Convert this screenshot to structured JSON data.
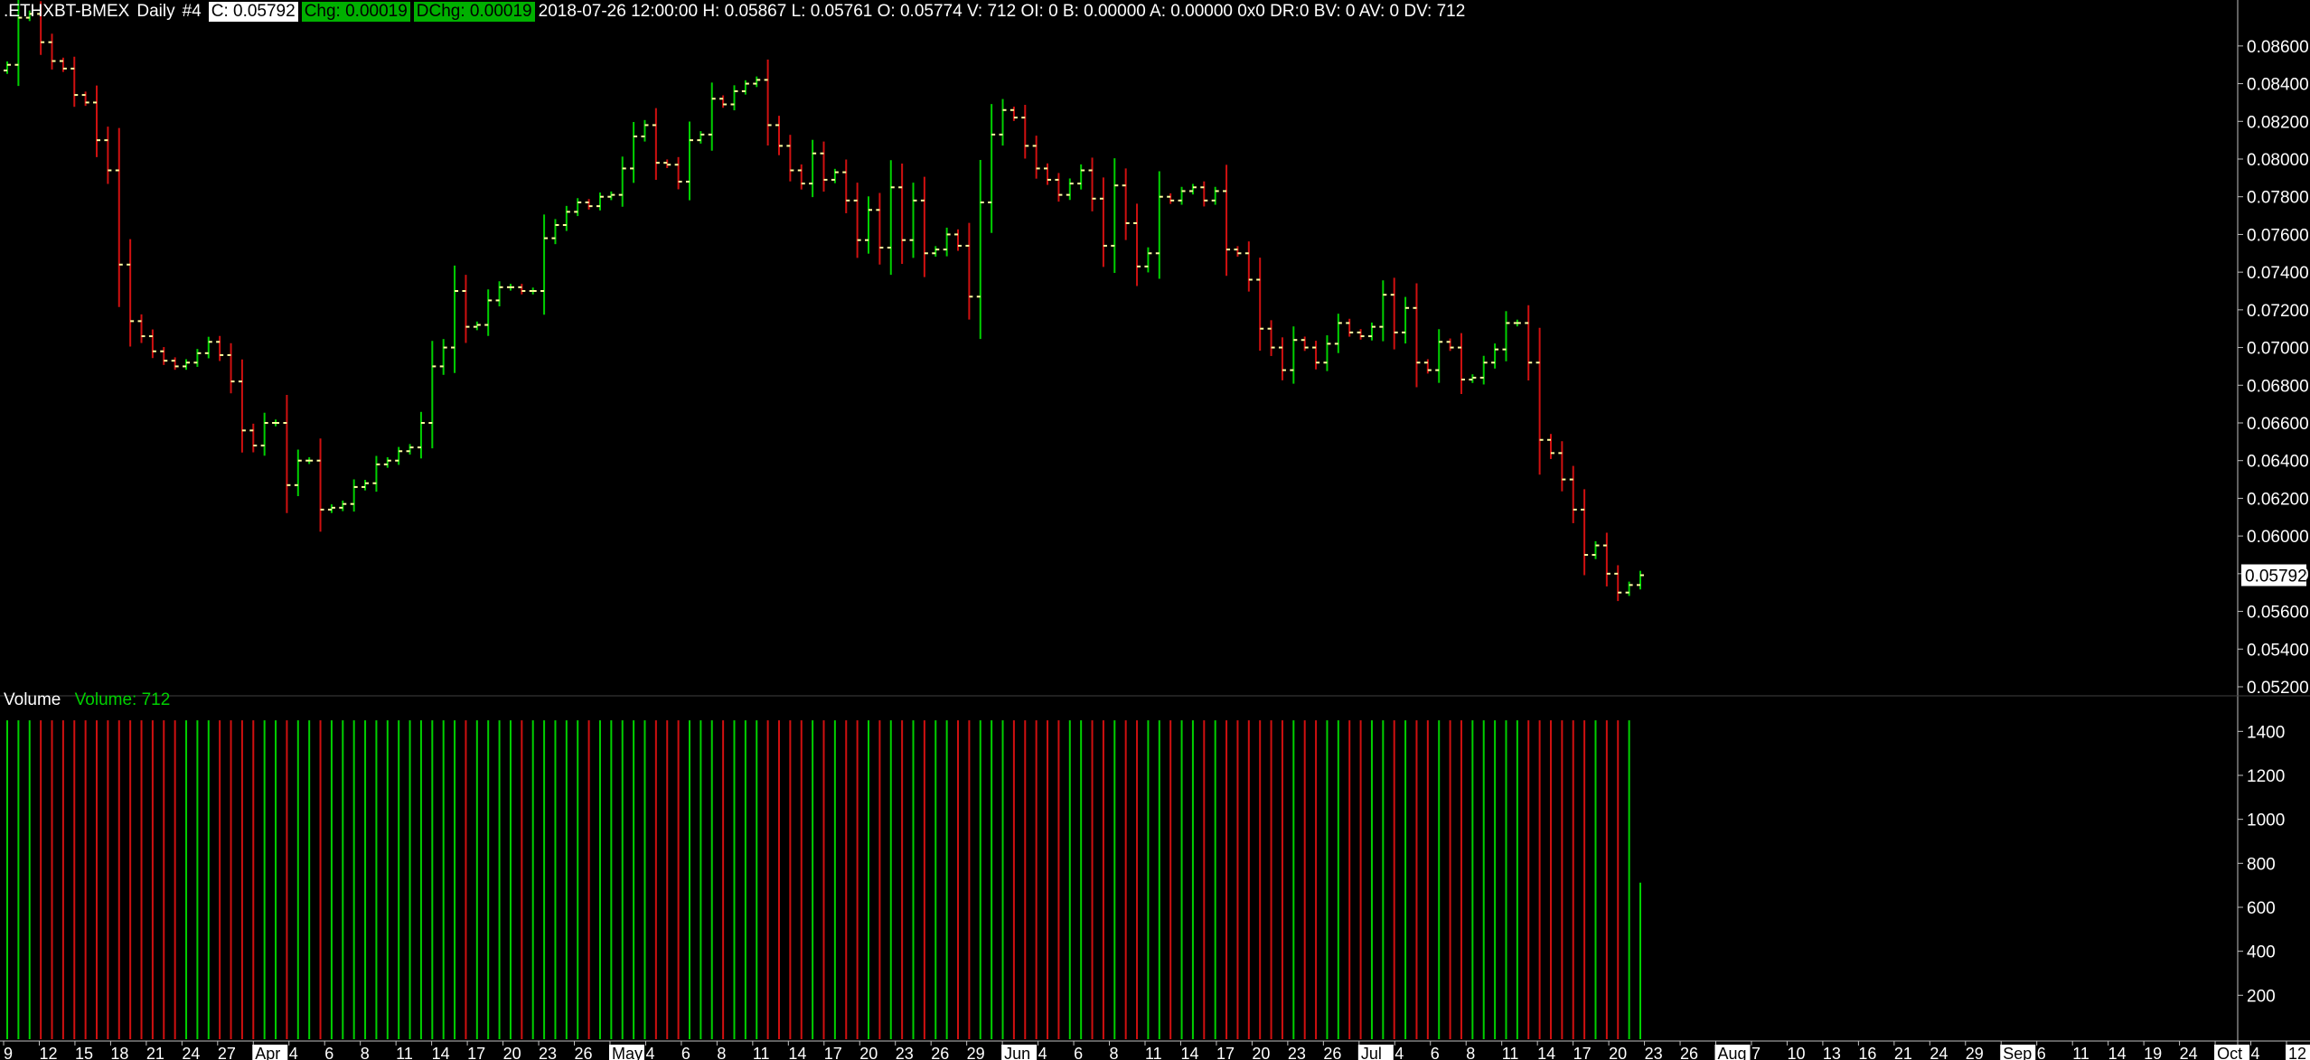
{
  "header": {
    "symbol": ".ETHXBT-BMEX",
    "interval": "Daily",
    "id": "#4",
    "close": "C: 0.05792",
    "chg": "Chg: 0.00019",
    "dchg": "DChg: 0.00019",
    "info": "2018-07-26 12:00:00 H: 0.05867 L: 0.05761 O: 0.05774 V: 712 OI: 0 B: 0.00000 A: 0.00000 0x0 DR:0 BV: 0 AV: 0 DV: 712"
  },
  "volume_header": {
    "label": "Volume",
    "value": "Volume: 712"
  },
  "colors": {
    "up": "#00d000",
    "down": "#d01010",
    "tick": "#ffffa0",
    "axis": "#ffffff",
    "month_bg": "#ffffff"
  },
  "chart_data": [
    {
      "type": "ohlc",
      "title": ".ETHXBT-BMEX Daily",
      "price_axis": {
        "ylim": [
          0.052,
          0.087
        ],
        "ticks": [
          "0.05200",
          "0.05400",
          "0.05600",
          "0.05800",
          "0.06000",
          "0.06200",
          "0.06400",
          "0.06600",
          "0.06800",
          "0.07000",
          "0.07200",
          "0.07400",
          "0.07600",
          "0.07800",
          "0.08000",
          "0.08200",
          "0.08400",
          "0.08600"
        ],
        "last_value_label": "0.05792",
        "last_value": 0.05792
      },
      "dates_start": "2018-03-09",
      "dates_end": "2018-07-26",
      "close": [
        0.085,
        0.0875,
        0.0877,
        0.0862,
        0.0852,
        0.0848,
        0.0834,
        0.083,
        0.081,
        0.0794,
        0.0744,
        0.0714,
        0.0706,
        0.0698,
        0.0693,
        0.069,
        0.0692,
        0.0697,
        0.0703,
        0.0696,
        0.0682,
        0.0656,
        0.0648,
        0.066,
        0.066,
        0.0627,
        0.064,
        0.064,
        0.0614,
        0.0615,
        0.0617,
        0.0626,
        0.0628,
        0.0638,
        0.064,
        0.0645,
        0.0647,
        0.066,
        0.069,
        0.07,
        0.073,
        0.0711,
        0.0712,
        0.0725,
        0.0732,
        0.0732,
        0.073,
        0.073,
        0.0758,
        0.0765,
        0.0772,
        0.0777,
        0.0775,
        0.078,
        0.0781,
        0.0795,
        0.0812,
        0.0818,
        0.0798,
        0.0797,
        0.0788,
        0.081,
        0.0813,
        0.0832,
        0.0829,
        0.0836,
        0.084,
        0.0842,
        0.0818,
        0.0807,
        0.0794,
        0.0787,
        0.0803,
        0.0789,
        0.0793,
        0.0778,
        0.0757,
        0.0773,
        0.0753,
        0.0785,
        0.0757,
        0.0778,
        0.075,
        0.0752,
        0.076,
        0.0754,
        0.0727,
        0.0777,
        0.0813,
        0.0826,
        0.0822,
        0.0807,
        0.0795,
        0.0789,
        0.0781,
        0.0787,
        0.0794,
        0.0779,
        0.0754,
        0.0786,
        0.0766,
        0.0743,
        0.075,
        0.078,
        0.0778,
        0.0783,
        0.0785,
        0.0778,
        0.0783,
        0.0752,
        0.075,
        0.0736,
        0.071,
        0.07,
        0.0688,
        0.0704,
        0.07,
        0.0692,
        0.0702,
        0.0713,
        0.0708,
        0.0706,
        0.0711,
        0.0728,
        0.0708,
        0.0721,
        0.0692,
        0.0688,
        0.0703,
        0.07,
        0.0683,
        0.0684,
        0.0692,
        0.0699,
        0.0713,
        0.0713,
        0.0692,
        0.0651,
        0.0644,
        0.063,
        0.0614,
        0.059,
        0.0595,
        0.058,
        0.057,
        0.0574,
        0.05792
      ],
      "ohlc_sample_note": "",
      "volume": {
        "ylim": [
          0,
          1500
        ],
        "ticks": [
          "200",
          "400",
          "600",
          "800",
          "1000",
          "1200",
          "1400"
        ],
        "last": 712
      },
      "x_axis": {
        "labels": [
          {
            "t": "9",
            "m": false
          },
          {
            "t": "12",
            "m": false
          },
          {
            "t": "15",
            "m": false
          },
          {
            "t": "18",
            "m": false
          },
          {
            "t": "21",
            "m": false
          },
          {
            "t": "24",
            "m": false
          },
          {
            "t": "27",
            "m": false
          },
          {
            "t": "Apr",
            "m": true
          },
          {
            "t": "4",
            "m": false
          },
          {
            "t": "6",
            "m": false
          },
          {
            "t": "8",
            "m": false
          },
          {
            "t": "11",
            "m": false
          },
          {
            "t": "14",
            "m": false
          },
          {
            "t": "17",
            "m": false
          },
          {
            "t": "20",
            "m": false
          },
          {
            "t": "23",
            "m": false
          },
          {
            "t": "26",
            "m": false
          },
          {
            "t": "May",
            "m": true
          },
          {
            "t": "4",
            "m": false
          },
          {
            "t": "6",
            "m": false
          },
          {
            "t": "8",
            "m": false
          },
          {
            "t": "11",
            "m": false
          },
          {
            "t": "14",
            "m": false
          },
          {
            "t": "17",
            "m": false
          },
          {
            "t": "20",
            "m": false
          },
          {
            "t": "23",
            "m": false
          },
          {
            "t": "26",
            "m": false
          },
          {
            "t": "29",
            "m": false
          },
          {
            "t": "Jun",
            "m": true
          },
          {
            "t": "4",
            "m": false
          },
          {
            "t": "6",
            "m": false
          },
          {
            "t": "8",
            "m": false
          },
          {
            "t": "11",
            "m": false
          },
          {
            "t": "14",
            "m": false
          },
          {
            "t": "17",
            "m": false
          },
          {
            "t": "20",
            "m": false
          },
          {
            "t": "23",
            "m": false
          },
          {
            "t": "26",
            "m": false
          },
          {
            "t": "Jul",
            "m": true
          },
          {
            "t": "4",
            "m": false
          },
          {
            "t": "6",
            "m": false
          },
          {
            "t": "8",
            "m": false
          },
          {
            "t": "11",
            "m": false
          },
          {
            "t": "14",
            "m": false
          },
          {
            "t": "17",
            "m": false
          },
          {
            "t": "20",
            "m": false
          },
          {
            "t": "23",
            "m": false
          },
          {
            "t": "26",
            "m": false
          },
          {
            "t": "Aug",
            "m": true
          },
          {
            "t": "7",
            "m": false
          },
          {
            "t": "10",
            "m": false
          },
          {
            "t": "13",
            "m": false
          },
          {
            "t": "16",
            "m": false
          },
          {
            "t": "21",
            "m": false
          },
          {
            "t": "24",
            "m": false
          },
          {
            "t": "29",
            "m": false
          },
          {
            "t": "Sep",
            "m": true
          },
          {
            "t": "6",
            "m": false
          },
          {
            "t": "11",
            "m": false
          },
          {
            "t": "14",
            "m": false
          },
          {
            "t": "19",
            "m": false
          },
          {
            "t": "24",
            "m": false
          },
          {
            "t": "Oct",
            "m": true
          },
          {
            "t": "4",
            "m": false
          },
          {
            "t": "12",
            "m": true
          }
        ]
      }
    }
  ]
}
